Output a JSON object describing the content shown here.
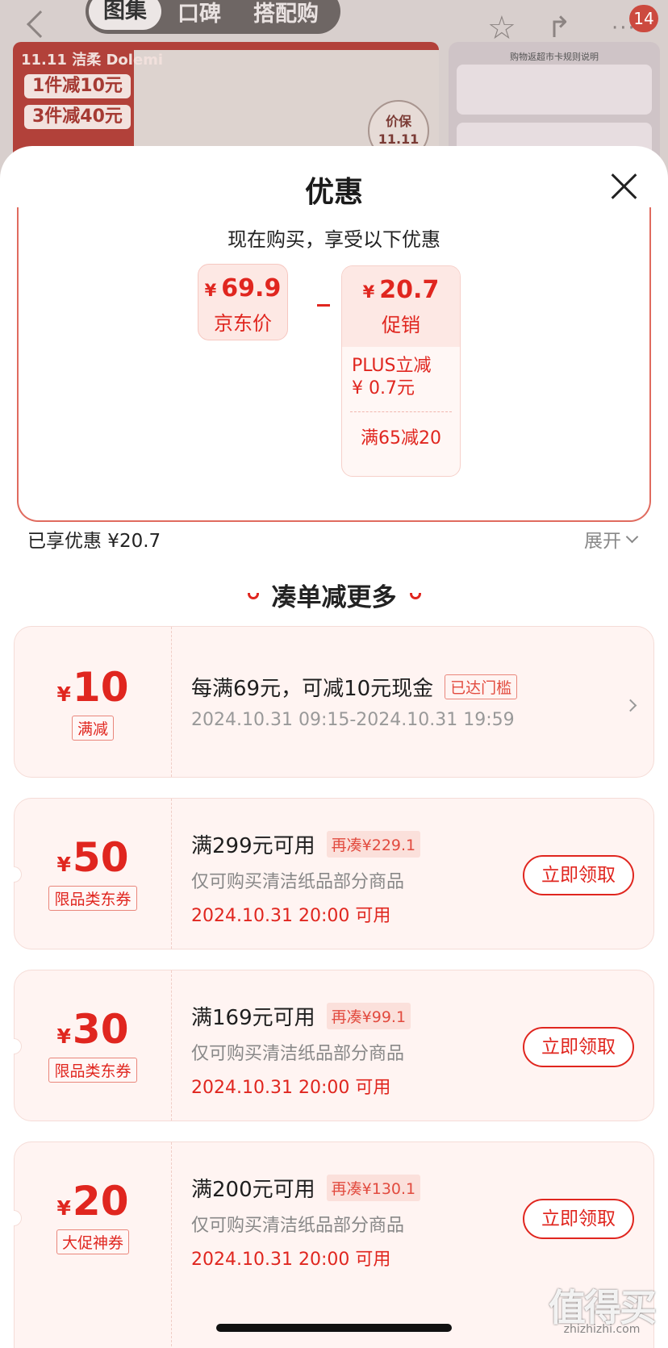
{
  "background": {
    "tabs": [
      "图集",
      "口碑",
      "搭配购"
    ],
    "badge_count": "14",
    "banner": {
      "brand": "11.11 洁柔 Dolemi",
      "promos": [
        "1件减10元",
        "3件减40元"
      ],
      "price_guard": [
        "价保",
        "11.11"
      ]
    },
    "side_title": "购物返超市卡规则说明"
  },
  "sheet": {
    "title": "优惠",
    "breakdown": {
      "heading": "现在购买，享受以下优惠",
      "currency": "¥",
      "jd_price": {
        "amount": "69.9",
        "label": "京东价"
      },
      "promo": {
        "amount": "20.7",
        "label": "促销",
        "plus_line1": "PLUS立减",
        "plus_line2": "¥ 0.7元",
        "threshold": "满65减20"
      }
    },
    "saved_text": "已享优惠 ¥20.7",
    "expand_label": "展开",
    "section_heading": "凑单减更多",
    "coupons": [
      {
        "value": "10",
        "tag": "满减",
        "desc": "每满69元，可减10元现金",
        "reached": "已达门槛",
        "time": "2024.10.31 09:15-2024.10.31 19:59"
      },
      {
        "value": "50",
        "tag": "限品类东券",
        "desc": "满299元可用",
        "need": "再凑¥229.1",
        "scope": "仅可购买清洁纸品部分商品",
        "time": "2024.10.31 20:00 可用",
        "button": "立即领取"
      },
      {
        "value": "30",
        "tag": "限品类东券",
        "desc": "满169元可用",
        "need": "再凑¥99.1",
        "scope": "仅可购买清洁纸品部分商品",
        "time": "2024.10.31 20:00 可用",
        "button": "立即领取"
      },
      {
        "value": "20",
        "tag": "大促神券",
        "desc": "满200元可用",
        "need": "再凑¥130.1",
        "scope": "仅可购买清洁纸品部分商品",
        "time": "2024.10.31 20:00 可用",
        "button": "立即领取"
      }
    ]
  },
  "watermark": {
    "main": "值得买",
    "sub": "zhizhizhi.com"
  },
  "colors": {
    "accent": "#e0261f",
    "coupon_bg": "#fff4f2",
    "overlay": "#d8cfcd"
  }
}
